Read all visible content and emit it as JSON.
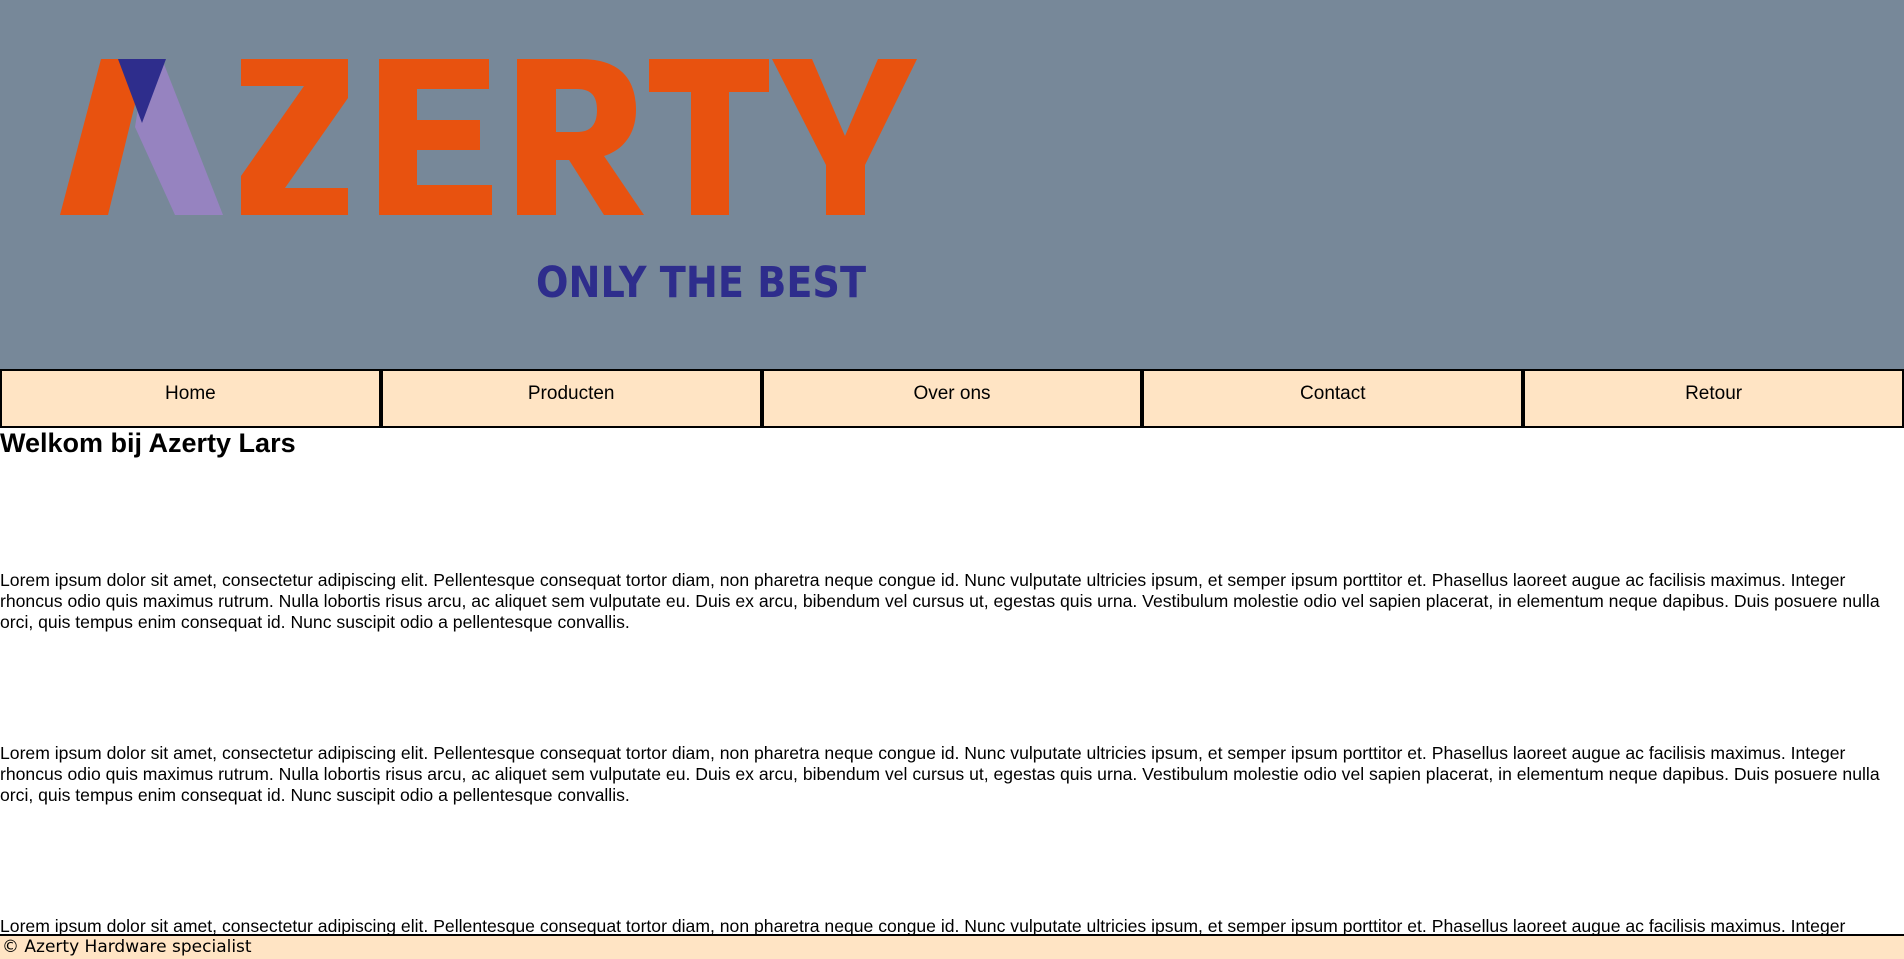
{
  "header": {
    "logo": {
      "wordmark": "AZERTY",
      "tagline": "ONLY THE BEST",
      "colors": {
        "orange": "#e8520f",
        "navy": "#2e2d8c",
        "lavender": "#9683c0"
      }
    },
    "background": "#778899"
  },
  "nav": {
    "items": [
      {
        "label": "Home"
      },
      {
        "label": "Producten"
      },
      {
        "label": "Over ons"
      },
      {
        "label": "Contact"
      },
      {
        "label": "Retour"
      }
    ],
    "background": "#ffe4c4"
  },
  "main": {
    "title": "Welkom bij Azerty Lars",
    "paragraphs": [
      "Lorem ipsum dolor sit amet, consectetur adipiscing elit. Pellentesque consequat tortor diam, non pharetra neque congue id. Nunc vulputate ultricies ipsum, et semper ipsum porttitor et. Phasellus laoreet augue ac facilisis maximus. Integer rhoncus odio quis maximus rutrum. Nulla lobortis risus arcu, ac aliquet sem vulputate eu. Duis ex arcu, bibendum vel cursus ut, egestas quis urna. Vestibulum molestie odio vel sapien placerat, in elementum neque dapibus. Duis posuere nulla orci, quis tempus enim consequat id. Nunc suscipit odio a pellentesque convallis.",
      "Lorem ipsum dolor sit amet, consectetur adipiscing elit. Pellentesque consequat tortor diam, non pharetra neque congue id. Nunc vulputate ultricies ipsum, et semper ipsum porttitor et. Phasellus laoreet augue ac facilisis maximus. Integer rhoncus odio quis maximus rutrum. Nulla lobortis risus arcu, ac aliquet sem vulputate eu. Duis ex arcu, bibendum vel cursus ut, egestas quis urna. Vestibulum molestie odio vel sapien placerat, in elementum neque dapibus. Duis posuere nulla orci, quis tempus enim consequat id. Nunc suscipit odio a pellentesque convallis.",
      "Lorem ipsum dolor sit amet, consectetur adipiscing elit. Pellentesque consequat tortor diam, non pharetra neque congue id. Nunc vulputate ultricies ipsum, et semper ipsum porttitor et. Phasellus laoreet augue ac facilisis maximus. Integer"
    ]
  },
  "footer": {
    "text": "© Azerty Hardware specialist"
  }
}
